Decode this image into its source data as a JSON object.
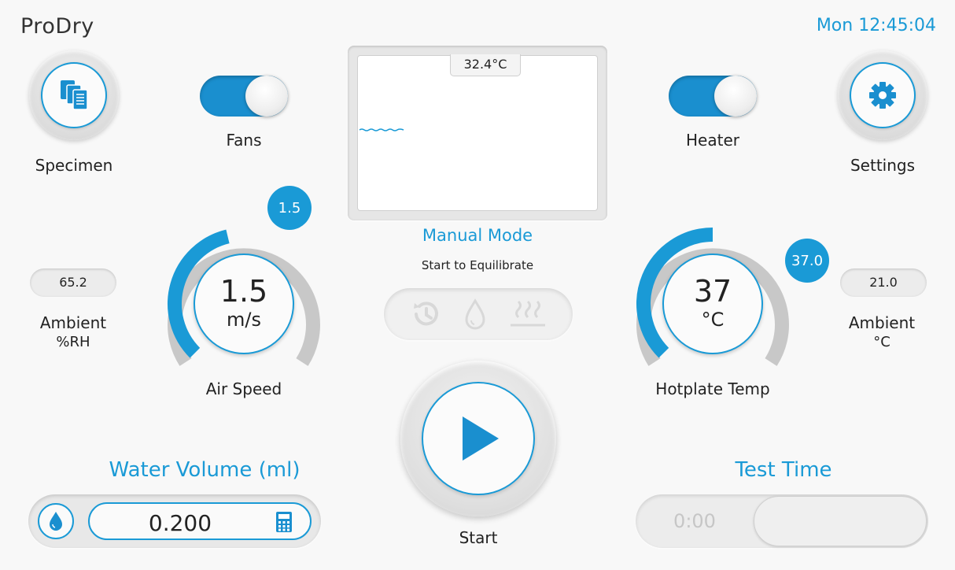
{
  "header": {
    "title": "ProDry",
    "clock": "Mon 12:45:04"
  },
  "specimen": {
    "label": "Specimen",
    "icon": "documents-icon"
  },
  "settings": {
    "label": "Settings",
    "icon": "gear-icon"
  },
  "fans": {
    "label": "Fans",
    "on": true
  },
  "heater": {
    "label": "Heater",
    "on": true
  },
  "graph": {
    "temperature_label": "32.4°C"
  },
  "mode": {
    "title": "Manual Mode",
    "subtitle": "Start to Equilibrate"
  },
  "status_icons": [
    "history-icon",
    "water-drop-icon",
    "heat-icon"
  ],
  "air_speed": {
    "value": "1.5",
    "unit": "m/s",
    "bubble": "1.5",
    "label": "Air Speed",
    "fill_fraction": 0.45
  },
  "hotplate": {
    "value": "37",
    "unit": "°C",
    "bubble": "37.0",
    "label": "Hotplate Temp",
    "fill_fraction": 0.5
  },
  "ambient_rh": {
    "value": "65.2",
    "label_line1": "Ambient",
    "label_line2": "%RH"
  },
  "ambient_temp": {
    "value": "21.0",
    "label_line1": "Ambient",
    "label_line2": "°C"
  },
  "start": {
    "label": "Start"
  },
  "water_volume": {
    "title": "Water Volume (ml)",
    "value": "0.200"
  },
  "test_time": {
    "title": "Test Time",
    "value": "0:00"
  },
  "colors": {
    "accent": "#1a9ad6",
    "background": "#f8f8f8"
  }
}
